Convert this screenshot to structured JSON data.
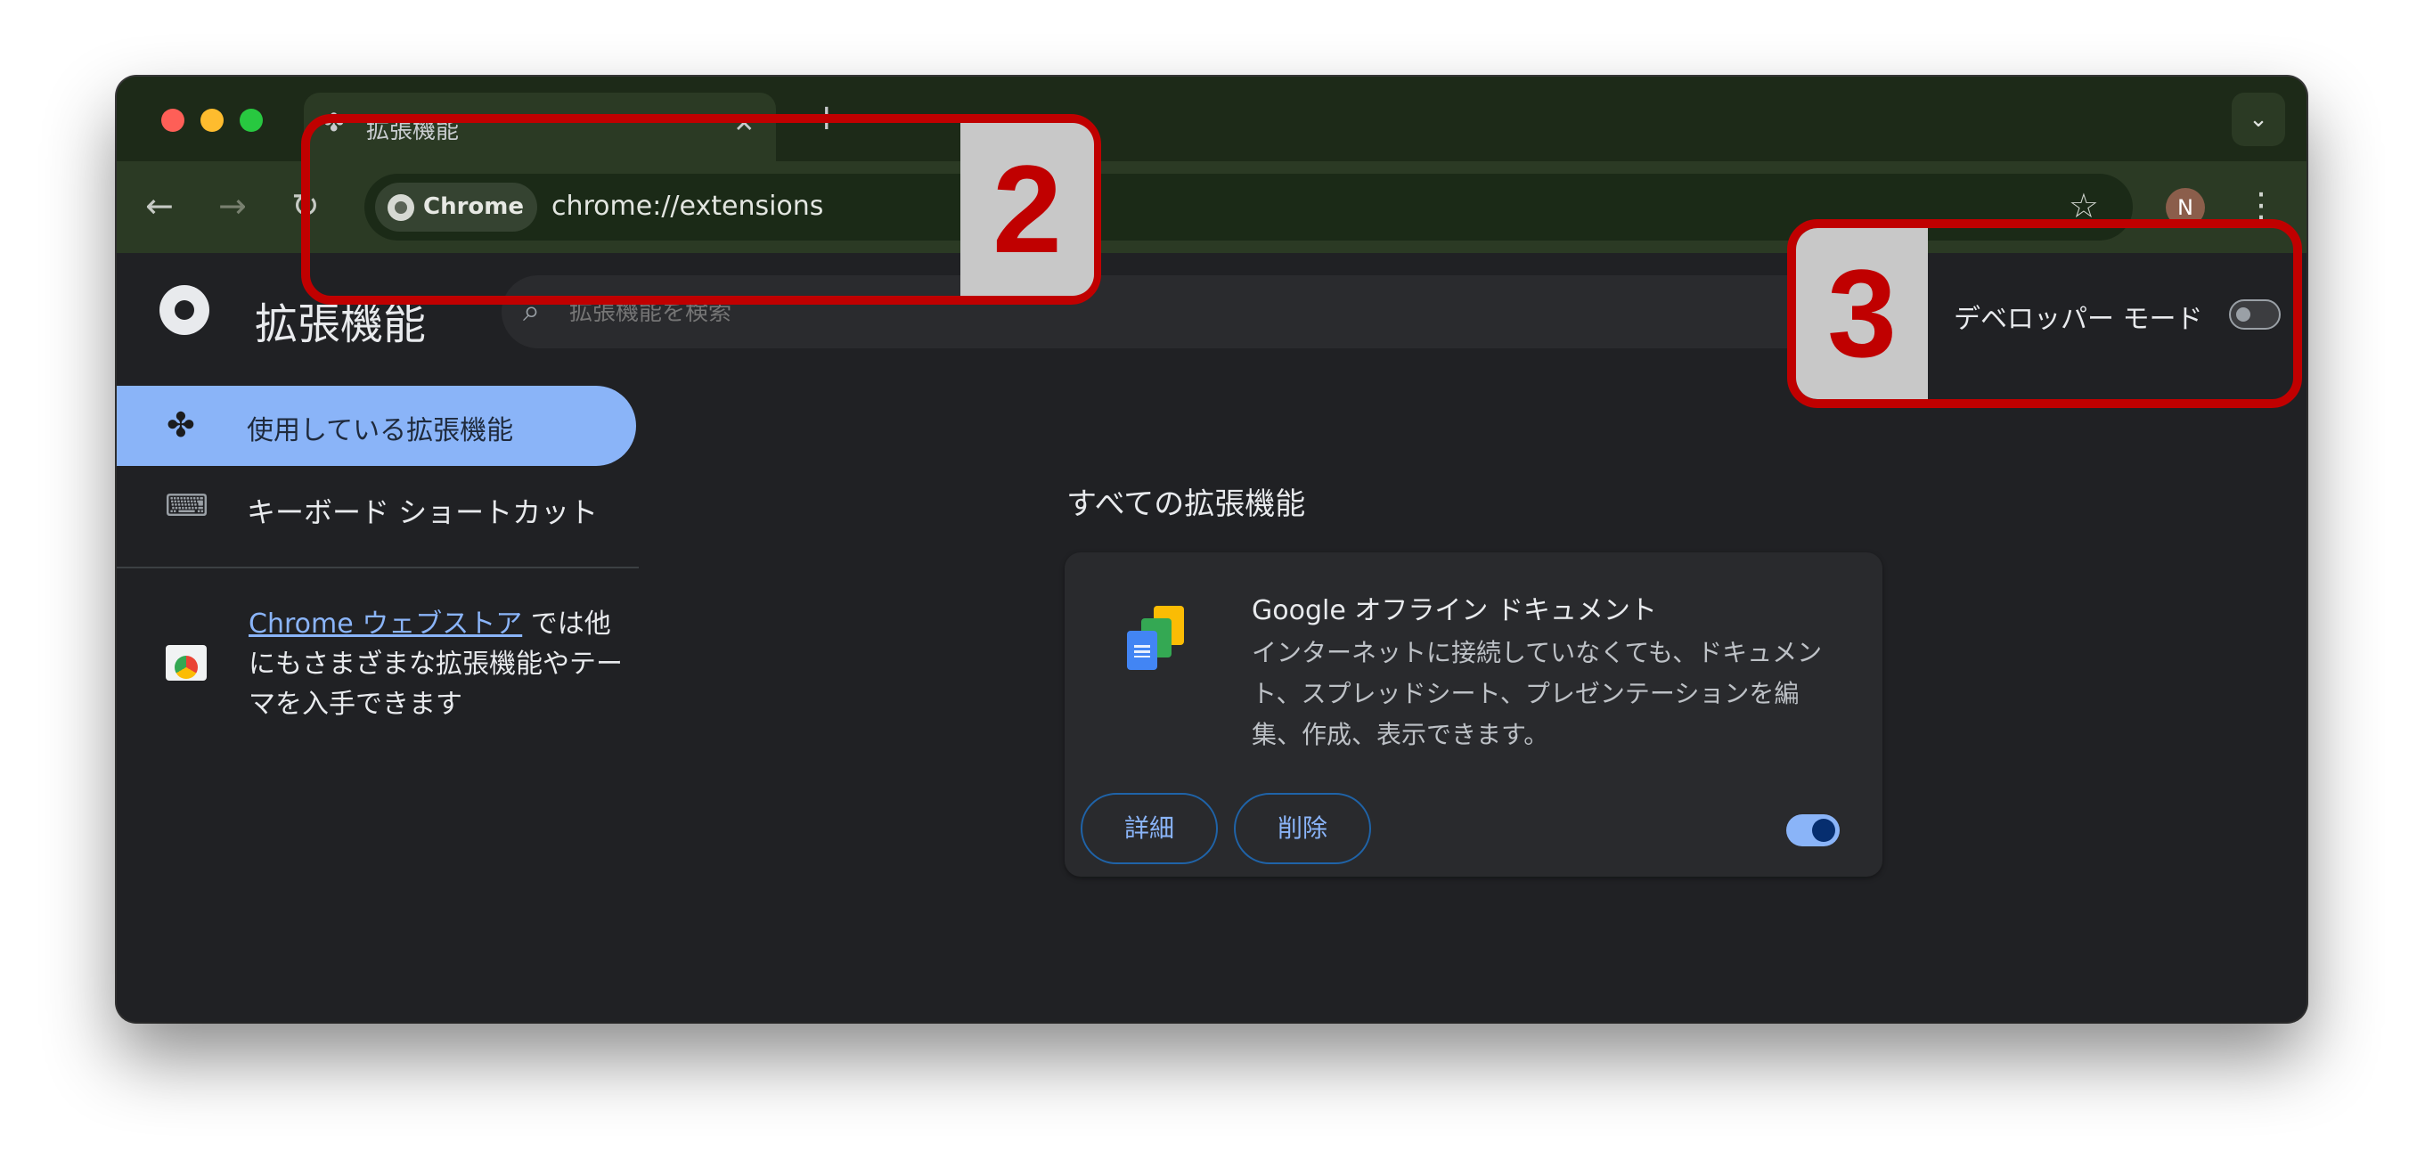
{
  "browser": {
    "tab": {
      "title": "拡張機能",
      "close": "✕"
    },
    "new_tab": "+",
    "tab_dropdown": "⌄",
    "omnibox": {
      "chip_label": "Chrome",
      "url": "chrome://extensions"
    },
    "profile_initial": "N"
  },
  "page": {
    "title": "拡張機能",
    "search_placeholder": "拡張機能を検索",
    "developer_mode_label": "デベロッパー モード",
    "developer_mode_on": false
  },
  "sidebar": {
    "items": [
      {
        "label": "使用している拡張機能",
        "active": true,
        "icon": "puzzle-icon"
      },
      {
        "label": "キーボード ショートカット",
        "active": false,
        "icon": "keyboard-icon"
      }
    ],
    "store": {
      "link_text": "Chrome ウェブストア",
      "rest_text": " では他にもさまざまな拡張機能やテーマを入手できます"
    }
  },
  "main": {
    "section_title": "すべての拡張機能",
    "extension": {
      "name": "Google オフライン ドキュメント",
      "description": "インターネットに接続していなくても、ドキュメント、スプレッドシート、プレゼンテーションを編集、作成、表示できます。",
      "details_label": "詳細",
      "remove_label": "削除",
      "enabled": true
    }
  },
  "annotations": [
    {
      "label": "2",
      "color": "#c00000"
    },
    {
      "label": "3",
      "color": "#c00000"
    }
  ]
}
